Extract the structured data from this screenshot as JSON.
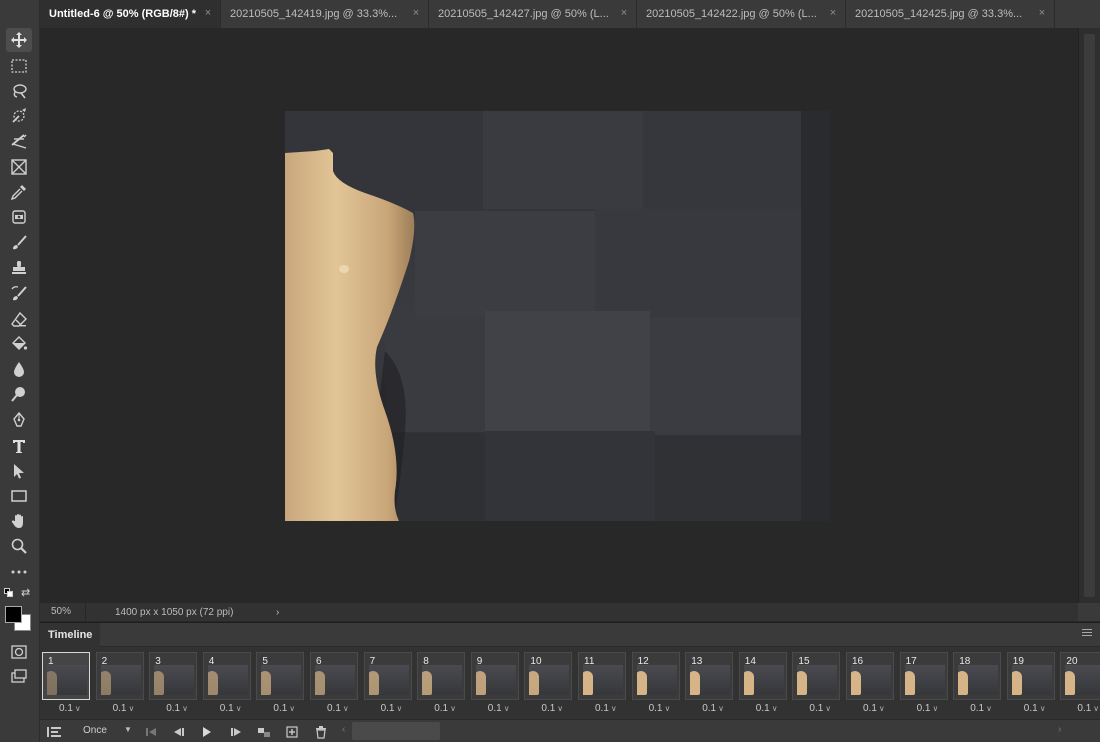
{
  "tabs": [
    {
      "label": "Untitled-6 @ 50% (RGB/8#) *",
      "active": true
    },
    {
      "label": "20210505_142419.jpg @ 33.3%...",
      "active": false
    },
    {
      "label": "20210505_142427.jpg @ 50% (L...",
      "active": false
    },
    {
      "label": "20210505_142422.jpg @ 50% (L...",
      "active": false
    },
    {
      "label": "20210505_142425.jpg @ 33.3%...",
      "active": false
    }
  ],
  "tab_close_glyph": "×",
  "tools": [
    {
      "icon": "move-icon"
    },
    {
      "icon": "rectangular-marquee-icon"
    },
    {
      "icon": "lasso-icon"
    },
    {
      "icon": "quick-selection-icon"
    },
    {
      "icon": "crop-icon"
    },
    {
      "icon": "frame-icon"
    },
    {
      "icon": "eyedropper-icon"
    },
    {
      "icon": "healing-brush-icon"
    },
    {
      "icon": "brush-icon"
    },
    {
      "icon": "clone-stamp-icon"
    },
    {
      "icon": "history-brush-icon"
    },
    {
      "icon": "eraser-icon"
    },
    {
      "icon": "paint-bucket-icon"
    },
    {
      "icon": "blur-icon"
    },
    {
      "icon": "dodge-icon"
    },
    {
      "icon": "pen-icon"
    },
    {
      "icon": "type-icon"
    },
    {
      "icon": "path-selection-icon"
    },
    {
      "icon": "rectangle-icon"
    },
    {
      "icon": "hand-icon"
    },
    {
      "icon": "zoom-icon"
    },
    {
      "icon": "more-tools-icon"
    },
    {
      "icon": "quick-mask-icon"
    },
    {
      "icon": "screen-mode-icon"
    }
  ],
  "colors": {
    "foreground": "#000000",
    "background": "#ffffff",
    "app_bg": "#282828",
    "panel_bg": "#3a3a3a"
  },
  "status": {
    "zoom": "50%",
    "doc_info": "1400 px x 1050 px (72 ppi)",
    "arrow": "›"
  },
  "timeline": {
    "title": "Timeline",
    "loop_option": "Once",
    "frames": [
      {
        "number": "1",
        "delay": "0.1",
        "selected": true,
        "opacity": 0.45
      },
      {
        "number": "2",
        "delay": "0.1",
        "selected": false,
        "opacity": 0.55
      },
      {
        "number": "3",
        "delay": "0.1",
        "selected": false,
        "opacity": 0.6
      },
      {
        "number": "4",
        "delay": "0.1",
        "selected": false,
        "opacity": 0.65
      },
      {
        "number": "5",
        "delay": "0.1",
        "selected": false,
        "opacity": 0.7
      },
      {
        "number": "6",
        "delay": "0.1",
        "selected": false,
        "opacity": 0.7
      },
      {
        "number": "7",
        "delay": "0.1",
        "selected": false,
        "opacity": 0.75
      },
      {
        "number": "8",
        "delay": "0.1",
        "selected": false,
        "opacity": 0.8
      },
      {
        "number": "9",
        "delay": "0.1",
        "selected": false,
        "opacity": 0.85
      },
      {
        "number": "10",
        "delay": "0.1",
        "selected": false,
        "opacity": 0.9
      },
      {
        "number": "11",
        "delay": "0.1",
        "selected": false,
        "opacity": 1
      },
      {
        "number": "12",
        "delay": "0.1",
        "selected": false,
        "opacity": 1
      },
      {
        "number": "13",
        "delay": "0.1",
        "selected": false,
        "opacity": 1
      },
      {
        "number": "14",
        "delay": "0.1",
        "selected": false,
        "opacity": 1
      },
      {
        "number": "15",
        "delay": "0.1",
        "selected": false,
        "opacity": 1
      },
      {
        "number": "16",
        "delay": "0.1",
        "selected": false,
        "opacity": 1
      },
      {
        "number": "17",
        "delay": "0.1",
        "selected": false,
        "opacity": 1
      },
      {
        "number": "18",
        "delay": "0.1",
        "selected": false,
        "opacity": 1
      },
      {
        "number": "19",
        "delay": "0.1",
        "selected": false,
        "opacity": 1
      },
      {
        "number": "20",
        "delay": "0.1",
        "selected": false,
        "opacity": 1
      }
    ],
    "controls": [
      {
        "icon": "convert-to-video-timeline-icon"
      },
      {
        "icon": "first-frame-icon"
      },
      {
        "icon": "previous-frame-icon"
      },
      {
        "icon": "play-icon"
      },
      {
        "icon": "next-frame-icon"
      },
      {
        "icon": "tween-icon"
      },
      {
        "icon": "duplicate-frame-icon"
      },
      {
        "icon": "delete-frame-icon"
      }
    ]
  }
}
